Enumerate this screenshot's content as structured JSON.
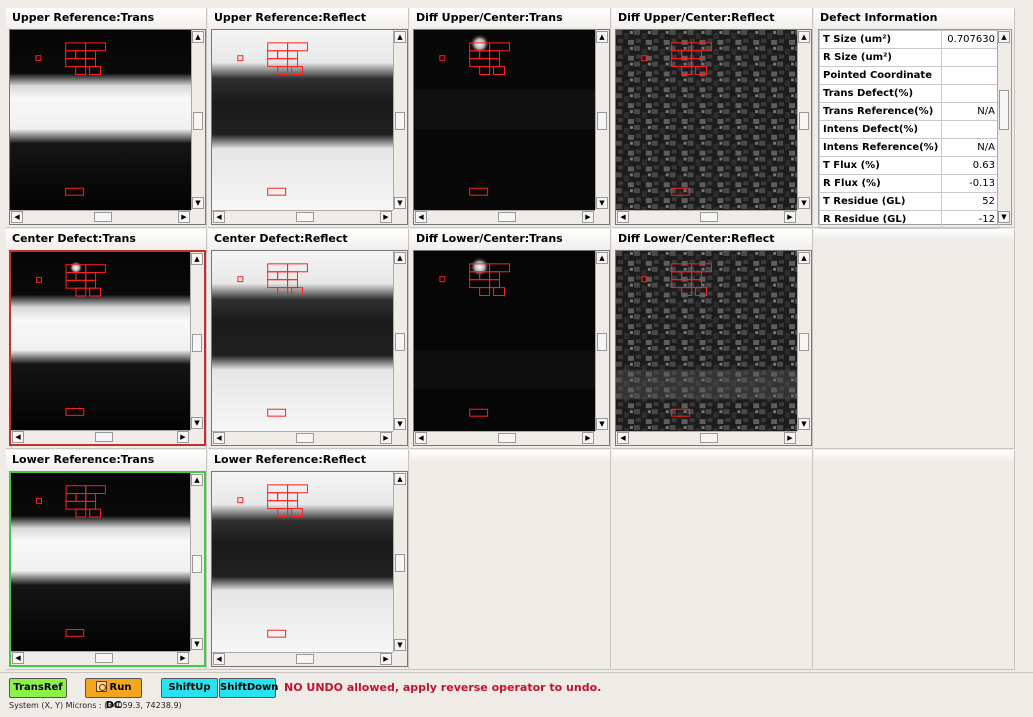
{
  "panels": {
    "upper_ref_trans": "Upper Reference:Trans",
    "upper_ref_reflect": "Upper Reference:Reflect",
    "diff_upper_trans": "Diff Upper/Center:Trans",
    "diff_upper_reflect": "Diff Upper/Center:Reflect",
    "center_trans": "Center Defect:Trans",
    "center_reflect": "Center Defect:Reflect",
    "diff_lower_trans": "Diff Lower/Center:Trans",
    "diff_lower_reflect": "Diff Lower/Center:Reflect",
    "lower_ref_trans": "Lower Reference:Trans",
    "lower_ref_reflect": "Lower Reference:Reflect"
  },
  "defect_info": {
    "title": "Defect Information",
    "rows": [
      {
        "label": "T Size (um²)",
        "value": "0.707630"
      },
      {
        "label": "R Size (um²)",
        "value": ""
      },
      {
        "label": "Pointed Coordinate",
        "value": ""
      },
      {
        "label": "Trans Defect(%)",
        "value": ""
      },
      {
        "label": "Trans Reference(%)",
        "value": "N/A"
      },
      {
        "label": "Intens Defect(%)",
        "value": ""
      },
      {
        "label": "Intens Reference(%)",
        "value": "N/A"
      },
      {
        "label": "T Flux (%)",
        "value": "0.63"
      },
      {
        "label": "R Flux (%)",
        "value": "-0.13"
      },
      {
        "label": "T Residue (GL)",
        "value": "52"
      },
      {
        "label": "R Residue (GL)",
        "value": "-12"
      }
    ]
  },
  "toolbar": {
    "transref_label": "TransRef",
    "rundc_label": "Run DC",
    "shiftup_label": "ShiftUp",
    "shiftdown_label": "ShiftDown",
    "warning": "NO UNDO allowed, apply reverse operator to undo."
  },
  "status": {
    "coords": "System (X, Y) Microns : (34059.3, 74238.9)"
  },
  "colors": {
    "transref": "#8cf24a",
    "rundc": "#f2a61f",
    "shift": "#28e2f0",
    "warning": "#c8102e",
    "center_selection": "#c23030",
    "lower_selection": "#46c846",
    "overlay": "#ff2020"
  },
  "icons": {
    "scroll_up": "▲",
    "scroll_down": "▼",
    "scroll_left": "◀",
    "scroll_right": "▶"
  }
}
